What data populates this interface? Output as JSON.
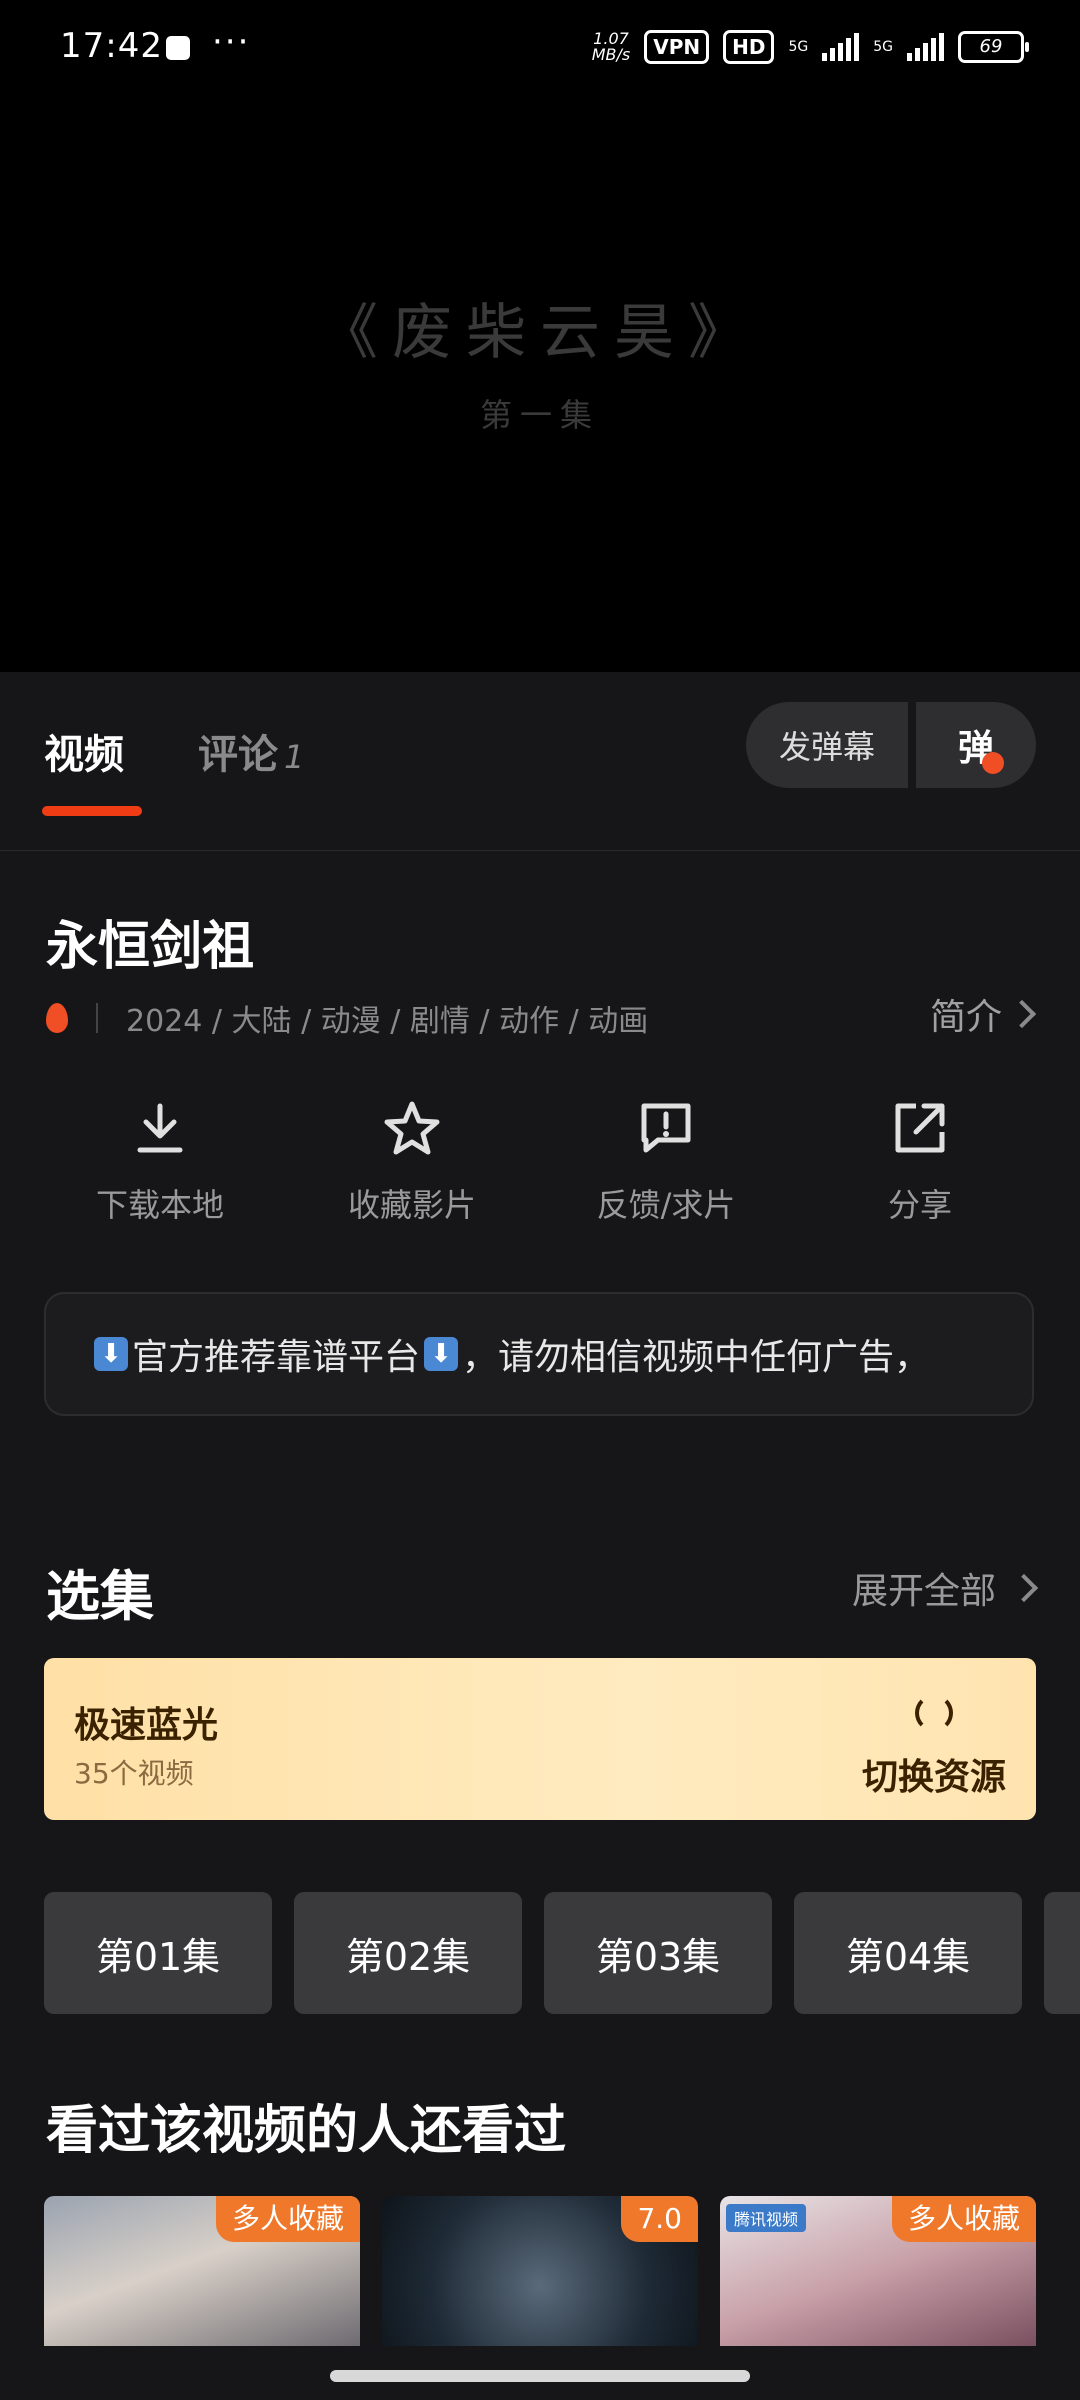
{
  "status_bar": {
    "time": "17:42",
    "speed_top": "1.07",
    "speed_bottom": "MB/s",
    "vpn": "VPN",
    "hd": "HD",
    "network_1": "5G",
    "network_2": "5G",
    "battery": "69"
  },
  "player": {
    "title": "《废柴云昊》",
    "subtitle": "第一集"
  },
  "tabs": {
    "video": "视频",
    "comments": "评论",
    "comments_count": "1"
  },
  "danmu": {
    "send_label": "发弹幕",
    "toggle_label": "弹"
  },
  "show": {
    "title": "永恒剑祖",
    "year": "2024",
    "meta": "2024 / 大陆 / 动漫 / 剧情 / 动作 / 动画",
    "intro_label": "简介"
  },
  "actions": [
    {
      "label": "下载本地",
      "icon": "download-icon"
    },
    {
      "label": "收藏影片",
      "icon": "star-icon"
    },
    {
      "label": "反馈/求片",
      "icon": "feedback-icon"
    },
    {
      "label": "分享",
      "icon": "share-icon"
    }
  ],
  "notice": {
    "text_a": "官方推荐靠谱平台",
    "text_b": "，请勿相信视频中任何广告，"
  },
  "episodes_section": {
    "title": "选集",
    "expand_label": "展开全部"
  },
  "source": {
    "name": "极速蓝光",
    "count": "35个视频",
    "switch_label": "切换资源"
  },
  "episodes": [
    "第01集",
    "第02集",
    "第03集",
    "第04集"
  ],
  "recommend": {
    "title": "看过该视频的人还看过",
    "items": [
      {
        "badge": "多人收藏"
      },
      {
        "badge": "7.0"
      },
      {
        "badge": "多人收藏",
        "tag": "腾讯视频"
      }
    ]
  },
  "colors": {
    "accent": "#f03c14",
    "badge": "#f0782a",
    "source_bg": "#ffe4b0"
  }
}
